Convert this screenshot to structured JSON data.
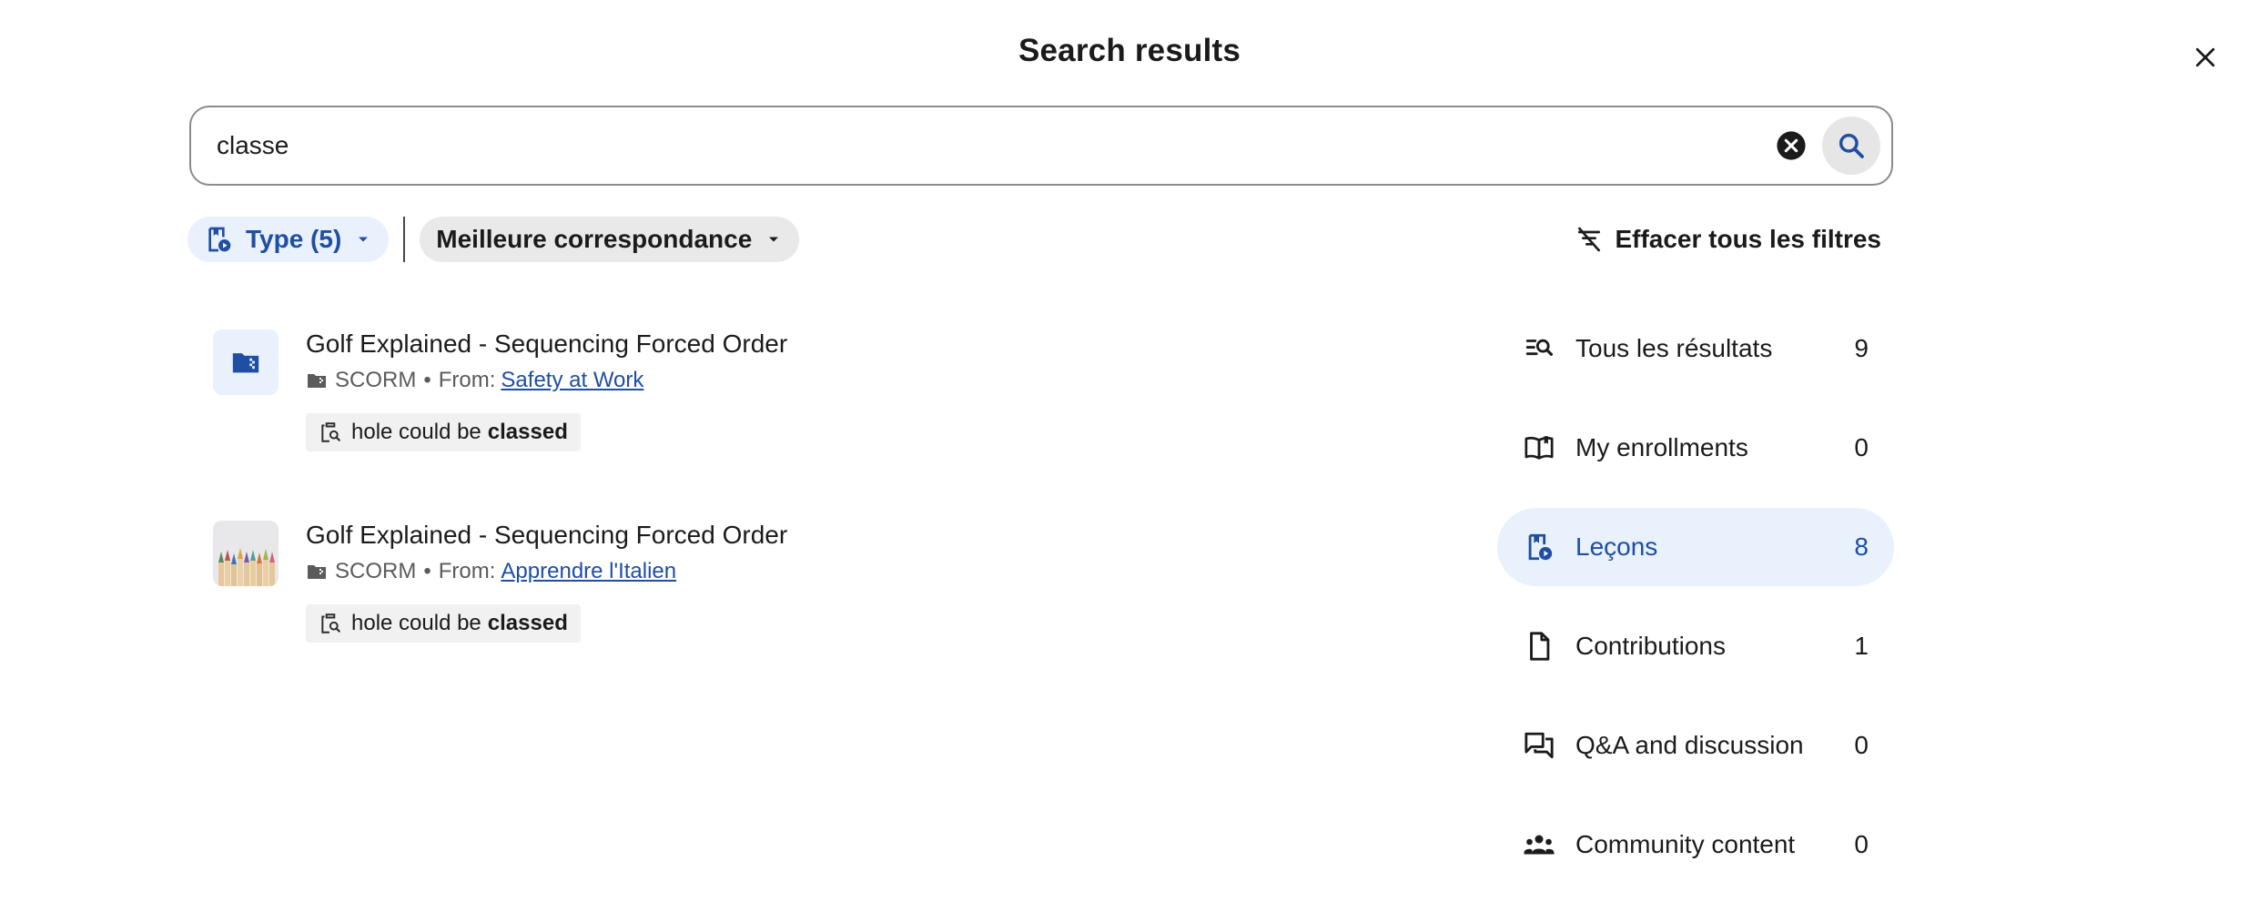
{
  "header": {
    "title": "Search results"
  },
  "search": {
    "value": "classe",
    "placeholder": ""
  },
  "filters": {
    "type_label": "Type (5)",
    "sort_label": "Meilleure correspondance",
    "clear_all_label": "Effacer tous les filtres"
  },
  "results": [
    {
      "title": "Golf Explained - Sequencing Forced Order",
      "kind": "SCORM",
      "from_label": "From:",
      "from_link": "Safety at Work",
      "snippet_prefix": "hole could be",
      "snippet_match": "classed",
      "icon": "scorm-folder-icon"
    },
    {
      "title": "Golf Explained - Sequencing Forced Order",
      "kind": "SCORM",
      "from_label": "From:",
      "from_link": "Apprendre l'Italien",
      "snippet_prefix": "hole could be",
      "snippet_match": "classed",
      "icon": "colored-pencils-thumbnail"
    }
  ],
  "separator": "•",
  "nav": {
    "items": [
      {
        "label": "Tous les résultats",
        "count": "9",
        "icon": "search-list-icon",
        "active": false
      },
      {
        "label": "My enrollments",
        "count": "0",
        "icon": "open-book-icon",
        "active": false
      },
      {
        "label": "Leçons",
        "count": "8",
        "icon": "lesson-icon",
        "active": true
      },
      {
        "label": "Contributions",
        "count": "1",
        "icon": "document-icon",
        "active": false
      },
      {
        "label": "Q&A and discussion",
        "count": "0",
        "icon": "forum-icon",
        "active": false
      },
      {
        "label": "Community content",
        "count": "0",
        "icon": "people-icon",
        "active": false
      }
    ]
  },
  "colors": {
    "accent": "#1f4ea3",
    "accent_soft": "#e9f1fd"
  }
}
